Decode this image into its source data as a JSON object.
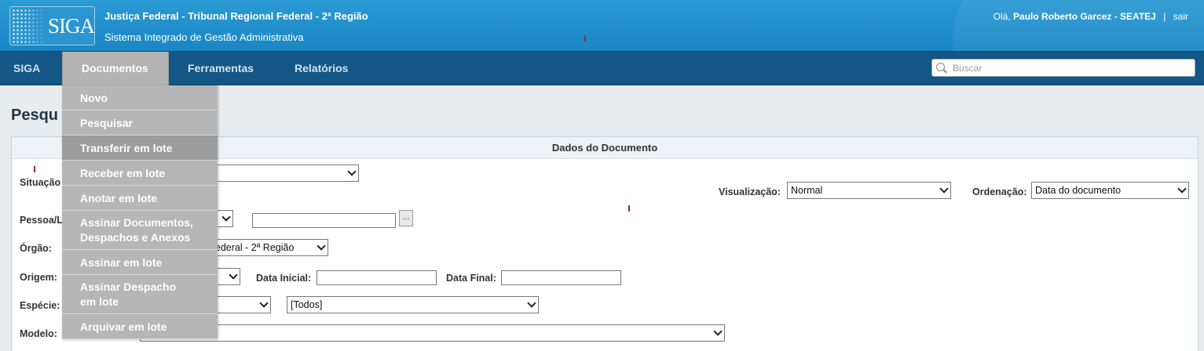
{
  "header": {
    "logo_text": "SIGA",
    "org_title": "Justiça Federal - Tribunal Regional Federal - 2ª Região",
    "system_title": "Sistema Integrado de Gestão Administrativa",
    "greeting": "Olá,",
    "user_name": "Paulo Roberto Garcez - SEATEJ",
    "separator": "|",
    "logout": "sair"
  },
  "nav": {
    "items": [
      {
        "label": "SIGA"
      },
      {
        "label": "Documentos"
      },
      {
        "label": "Ferramentas"
      },
      {
        "label": "Relatórios"
      }
    ],
    "active": "Documentos",
    "search_placeholder": "Buscar"
  },
  "dropdown": {
    "items": [
      {
        "label": "Novo"
      },
      {
        "label": "Pesquisar"
      },
      {
        "label": "Transferir em lote"
      },
      {
        "label": "Receber em lote"
      },
      {
        "label": "Anotar em lote"
      },
      {
        "label_line1": "Assinar Documentos,",
        "label_line2": "Despachos e Anexos"
      },
      {
        "label": "Assinar em lote"
      },
      {
        "label_line1": "Assinar Despacho",
        "label_line2": "em lote"
      },
      {
        "label": "Arquivar em lote"
      }
    ],
    "highlighted": "Transferir em lote"
  },
  "page": {
    "title_visible": "Pesqu",
    "panel_header": "Dados do Documento",
    "form": {
      "situacao_label": "Situação",
      "visualizacao_label": "Visualização:",
      "visualizacao_value": "Normal",
      "ordenacao_label": "Ordenação:",
      "ordenacao_value": "Data do documento",
      "pessoa_label": "Pessoa/L",
      "lookup_button": "...",
      "orgao_label": "Órgão:",
      "orgao_value": "l Federal - 2ª Região",
      "origem_label": "Origem:",
      "data_inicial_label": "Data Inicial:",
      "data_final_label": "Data Final:",
      "especie_label": "Espécie:",
      "especie_sub_value": "[Todos]",
      "modelo_label": "Modelo:"
    }
  }
}
